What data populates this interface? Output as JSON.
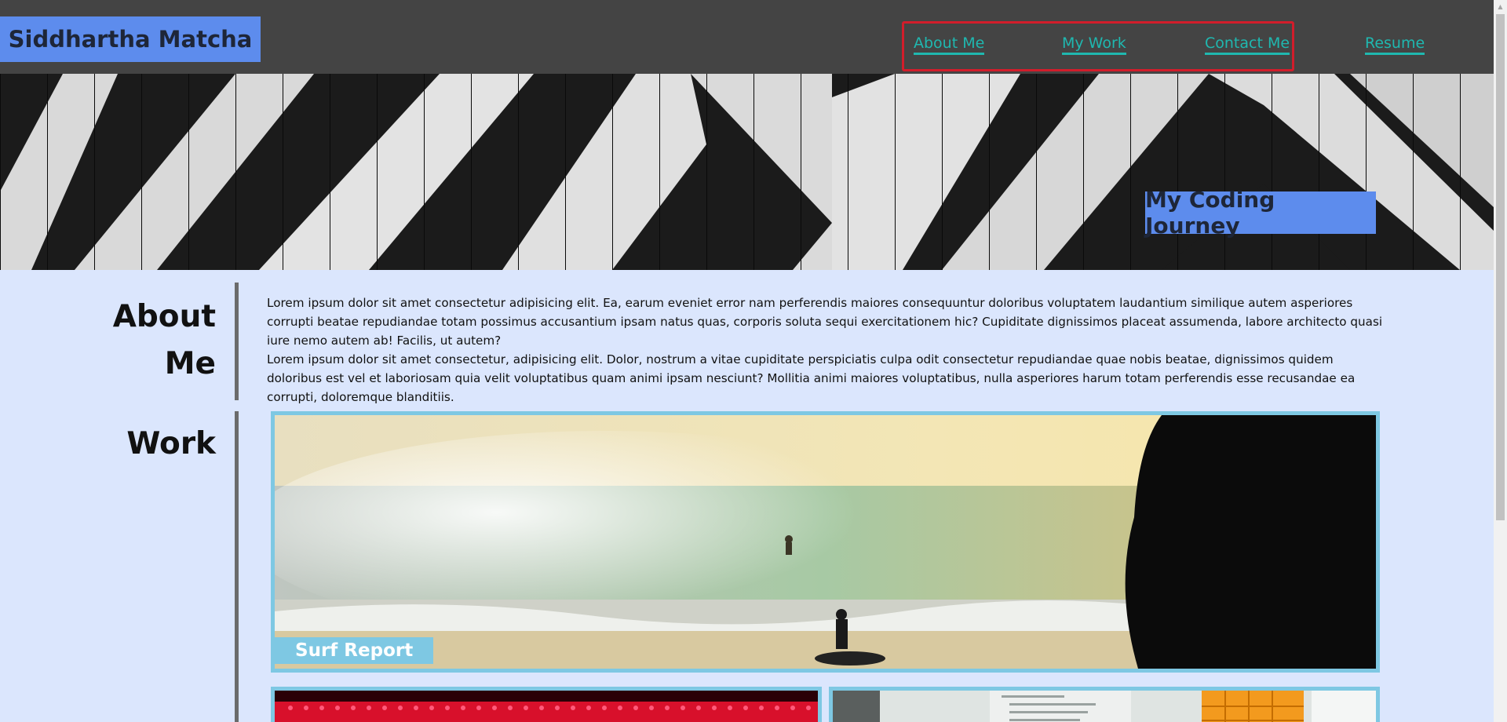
{
  "header": {
    "brand": "Siddhartha Matcha",
    "nav": [
      {
        "label": "About Me"
      },
      {
        "label": "My Work"
      },
      {
        "label": "Contact Me"
      },
      {
        "label": "Resume"
      }
    ]
  },
  "hero": {
    "title": "My Coding Journey"
  },
  "about": {
    "heading_line1": "About",
    "heading_line2": "Me",
    "paragraph1": "Lorem ipsum dolor sit amet consectetur adipisicing elit. Ea, earum eveniet error nam perferendis maiores consequuntur doloribus voluptatem laudantium similique autem asperiores corrupti beatae repudiandae totam possimus accusantium ipsam natus quas, corporis soluta sequi exercitationem hic? Cupiditate dignissimos placeat assumenda, labore architecto quasi iure nemo autem ab! Facilis, ut autem?",
    "paragraph2": "Lorem ipsum dolor sit amet consectetur, adipisicing elit. Dolor, nostrum a vitae cupiditate perspiciatis culpa odit consectetur repudiandae quae nobis beatae, dignissimos quidem doloribus est vel et laboriosam quia velit voluptatibus quam animi ipsam nesciunt? Mollitia animi maiores voluptatibus, nulla asperiores harum totam perferendis esse recusandae ea corrupti, doloremque blanditiis."
  },
  "work": {
    "heading": "Work",
    "featured": {
      "label": "Surf Report"
    }
  },
  "colors": {
    "header_bg": "#444444",
    "brand_bg": "#5d8ced",
    "nav_link": "#1fb8b0",
    "nav_highlight": "#d21d2b",
    "page_bg": "#dbe6fd",
    "card_border": "#7ec8e3"
  }
}
